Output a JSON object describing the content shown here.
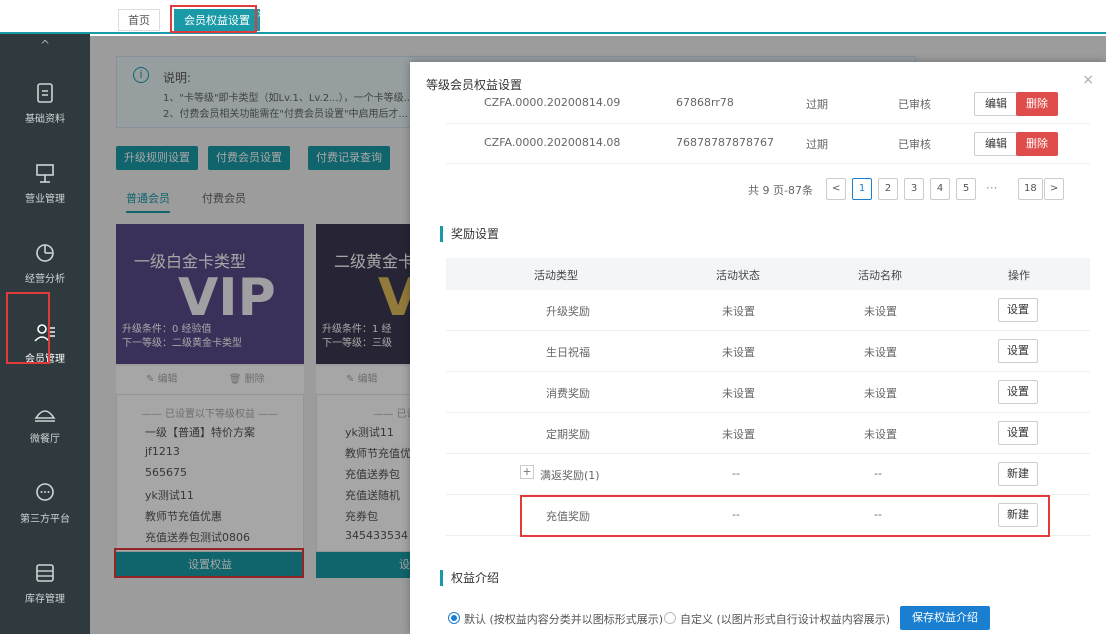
{
  "tabs": [
    {
      "label": "首页"
    },
    {
      "label": "会员权益设置",
      "close": "×"
    }
  ],
  "sidebar": {
    "collapse": "^",
    "items": [
      {
        "label": "基础资料",
        "icon": "document-icon"
      },
      {
        "label": "营业管理",
        "icon": "cashier-icon"
      },
      {
        "label": "经营分析",
        "icon": "chart-icon"
      },
      {
        "label": "会员管理",
        "icon": "member-icon"
      },
      {
        "label": "微餐厅",
        "icon": "dish-icon"
      },
      {
        "label": "第三方平台",
        "icon": "chat-icon"
      },
      {
        "label": "库存管理",
        "icon": "inventory-icon"
      }
    ]
  },
  "background": {
    "notice_title": "说明:",
    "notice_line1": "1、\"卡等级\"即卡类型（如Lv.1、Lv.2...），一个卡等级...",
    "notice_line2": "2、付费会员相关功能需在\"付费会员设置\"中启用后才...",
    "buttons": [
      "升级规则设置",
      "付费会员设置",
      "付费记录查询"
    ],
    "subtabs": [
      "普通会员",
      "付费会员"
    ],
    "card1": {
      "title": "一级白金卡类型",
      "vip": "VIP",
      "cond": "升级条件：0 经验值",
      "next": "下一等级：二级黄金卡类型",
      "edit": "编辑",
      "delete": "删除",
      "list_header": "—— 已设置以下等级权益 ——",
      "list": [
        "一级【普通】特价方案",
        "jf1213",
        "565675",
        "yk测试11",
        "教师节充值优惠",
        "充值送券包测试0806"
      ],
      "set_button": "设置权益"
    },
    "card2": {
      "title": "二级黄金卡",
      "vip": "VI",
      "cond": "升级条件：1 经",
      "next": "下一等级：三级",
      "edit": "编辑",
      "list_header": "—— 已设置以下",
      "list": [
        "yk测试11",
        "教师节充值优",
        "充值送券包",
        "充值送随机",
        "充券包",
        "345433534"
      ],
      "set_button": "设置"
    }
  },
  "modal": {
    "title": "等级会员权益设置",
    "close": "×",
    "records": [
      {
        "code": "CZFA.0000.20200814.09",
        "num": "67868rr78",
        "status": "过期",
        "audit": "已审核",
        "edit": "编辑",
        "delete": "删除"
      },
      {
        "code": "CZFA.0000.20200814.08",
        "num": "76878787878767",
        "status": "过期",
        "audit": "已审核",
        "edit": "编辑",
        "delete": "删除"
      }
    ],
    "pagination": {
      "summary": "共 9 页-87条",
      "prev": "<",
      "pages": [
        "1",
        "2",
        "3",
        "4",
        "5"
      ],
      "ellipsis": "···",
      "last": "18",
      "next": ">"
    },
    "reward_section": "奖励设置",
    "reward_headers": [
      "活动类型",
      "活动状态",
      "活动名称",
      "操作"
    ],
    "reward_rows": [
      {
        "type": "升级奖励",
        "status": "未设置",
        "name": "未设置",
        "action": "设置"
      },
      {
        "type": "生日祝福",
        "status": "未设置",
        "name": "未设置",
        "action": "设置"
      },
      {
        "type": "消费奖励",
        "status": "未设置",
        "name": "未设置",
        "action": "设置"
      },
      {
        "type": "定期奖励",
        "status": "未设置",
        "name": "未设置",
        "action": "设置"
      },
      {
        "type": "满返奖励(1)",
        "status": "--",
        "name": "--",
        "action": "新建",
        "expand": "+"
      },
      {
        "type": "充值奖励",
        "status": "--",
        "name": "--",
        "action": "新建"
      }
    ],
    "intro_section": "权益介绍",
    "intro_options": [
      {
        "label": "默认 (按权益内容分类并以图标形式展示)",
        "selected": true
      },
      {
        "label": "自定义 (以图片形式自行设计权益内容展示)",
        "selected": false
      }
    ],
    "save_button": "保存权益介绍"
  },
  "colors": {
    "teal": "#1a9aa6",
    "sidebar": "#2f3a3e",
    "danger": "#e04c4c",
    "primary": "#1a7fd0",
    "highlight": "#e03a3a"
  }
}
